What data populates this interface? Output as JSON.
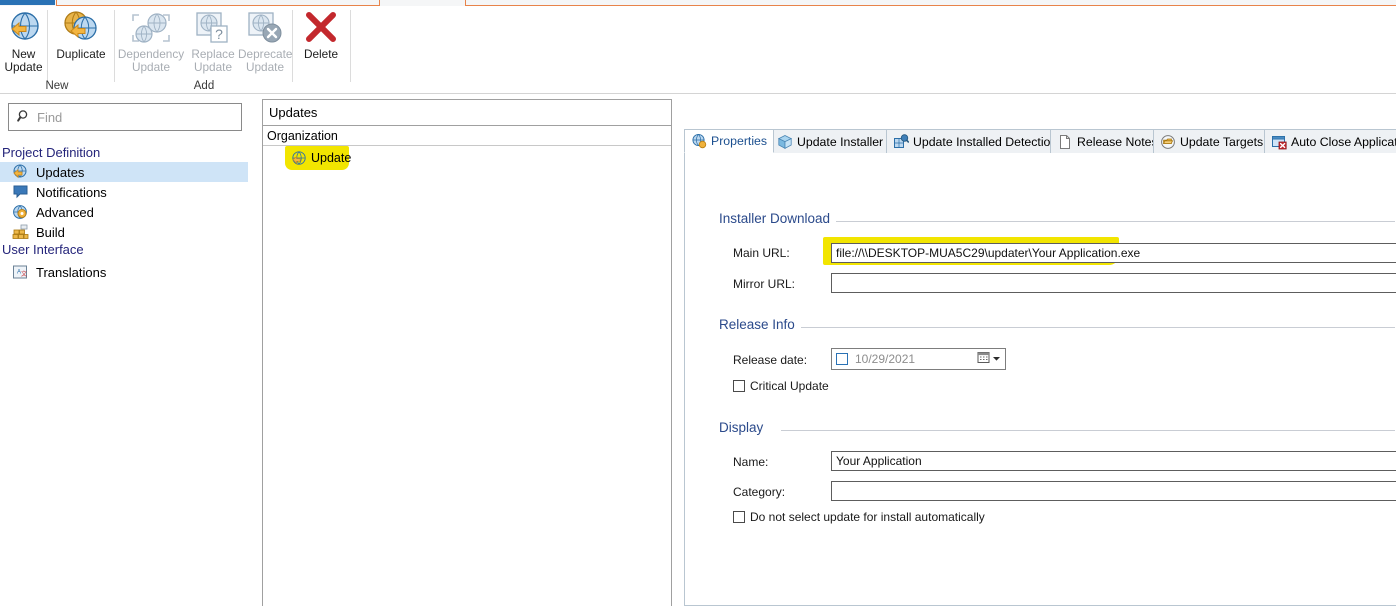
{
  "ribbon": {
    "groups": [
      {
        "label": "New"
      },
      {
        "label": "Add"
      }
    ],
    "buttons": [
      {
        "name": "new-update",
        "label_line1": "New",
        "label_line2": "Update",
        "icon": "globe-arrow-icon",
        "disabled": false
      },
      {
        "name": "duplicate",
        "label_line1": "Duplicate",
        "label_line2": "",
        "icon": "duplicate-globe-icon",
        "disabled": false
      },
      {
        "name": "dependency-update",
        "label_line1": "Dependency",
        "label_line2": "Update",
        "icon": "dependency-globe-icon",
        "disabled": true
      },
      {
        "name": "replace-update",
        "label_line1": "Replace",
        "label_line2": "Update",
        "icon": "replace-globe-question-icon",
        "disabled": true
      },
      {
        "name": "deprecate-update",
        "label_line1": "Deprecate",
        "label_line2": "Update",
        "icon": "deprecate-globe-x-icon",
        "disabled": true
      },
      {
        "name": "delete",
        "label_line1": "Delete",
        "label_line2": "",
        "icon": "red-x-icon",
        "disabled": false
      }
    ]
  },
  "sidebar": {
    "find": {
      "placeholder": "Find",
      "value": "",
      "icon": "search-icon"
    },
    "sections": [
      {
        "header": "Project Definition",
        "items": [
          {
            "label": "Updates",
            "icon": "updates-globe-icon",
            "selected": true
          },
          {
            "label": "Notifications",
            "icon": "notifications-balloon-icon",
            "selected": false
          },
          {
            "label": "Advanced",
            "icon": "advanced-gear-icon",
            "selected": false
          },
          {
            "label": "Build",
            "icon": "build-bricks-icon",
            "selected": false
          }
        ]
      },
      {
        "header": "User Interface",
        "items": [
          {
            "label": "Translations",
            "icon": "translations-icon",
            "selected": false
          }
        ]
      }
    ]
  },
  "middle_panel": {
    "title": "Updates",
    "column_header": "Organization",
    "tree": [
      {
        "label": "Update",
        "icon": "update-node-icon",
        "highlighted": true
      }
    ]
  },
  "tabs": [
    {
      "label": "Properties",
      "icon": "properties-globe-icon",
      "active": true
    },
    {
      "label": "Update Installer",
      "icon": "package-box-icon",
      "active": false
    },
    {
      "label": "Update Installed Detection",
      "icon": "detection-icon",
      "active": false
    },
    {
      "label": "Release Notes",
      "icon": "page-icon",
      "active": false
    },
    {
      "label": "Update Targets",
      "icon": "target-folder-icon",
      "active": false
    },
    {
      "label": "Auto Close Applications",
      "icon": "auto-close-window-icon",
      "active": false
    }
  ],
  "form": {
    "installer_download": {
      "title": "Installer Download",
      "main_url": {
        "label": "Main URL:",
        "value": "file://\\\\DESKTOP-MUA5C29\\updater\\Your Application.exe",
        "highlighted": true
      },
      "mirror_url": {
        "label": "Mirror URL:",
        "value": ""
      }
    },
    "release_info": {
      "title": "Release Info",
      "release_date": {
        "label": "Release date:",
        "value": "10/29/2021",
        "checked": false,
        "dropdown_icon": "calendar-icon"
      },
      "critical_update": {
        "label": "Critical Update",
        "checked": false
      }
    },
    "display": {
      "title": "Display",
      "name": {
        "label": "Name:",
        "value": "Your Application"
      },
      "category": {
        "label": "Category:",
        "value": ""
      },
      "do_not_select": {
        "label": "Do not select update for install automatically",
        "checked": false
      }
    }
  },
  "colors": {
    "accent_blue": "#2a72b5",
    "section_title": "#2b4a8b",
    "sidebar_header": "#24247a",
    "highlight_yellow": "#f2e500",
    "selection_blue": "#cfe4f7",
    "tab_orange": "#e8834a",
    "delete_red": "#c3282d"
  }
}
